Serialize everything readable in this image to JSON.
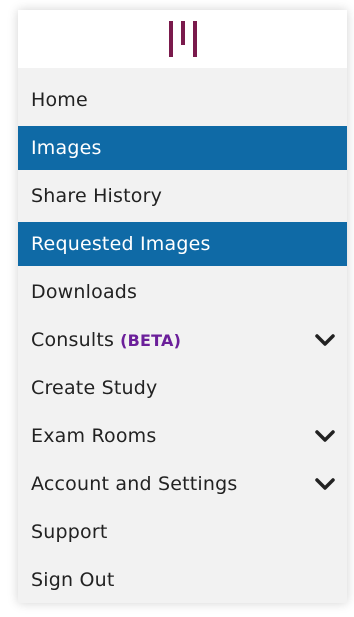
{
  "logo": {
    "icon": "triple-bar-logo-icon",
    "color": "#7a1a4c"
  },
  "colors": {
    "active_bg": "#0f6aa6",
    "beta": "#6b1f9a",
    "panel_bg": "#f2f2f2"
  },
  "menu": {
    "items": [
      {
        "label": "Home",
        "active": false
      },
      {
        "label": "Images",
        "active": true
      },
      {
        "label": "Share History",
        "active": false
      },
      {
        "label": "Requested Images",
        "active": true
      },
      {
        "label": "Downloads",
        "active": false
      },
      {
        "label": "Consults",
        "badge": "(BETA)",
        "expandable": true
      },
      {
        "label": "Create Study",
        "active": false
      },
      {
        "label": "Exam Rooms",
        "expandable": true
      },
      {
        "label": "Account and Settings",
        "expandable": true
      },
      {
        "label": "Support",
        "active": false
      },
      {
        "label": "Sign Out",
        "active": false
      }
    ]
  }
}
